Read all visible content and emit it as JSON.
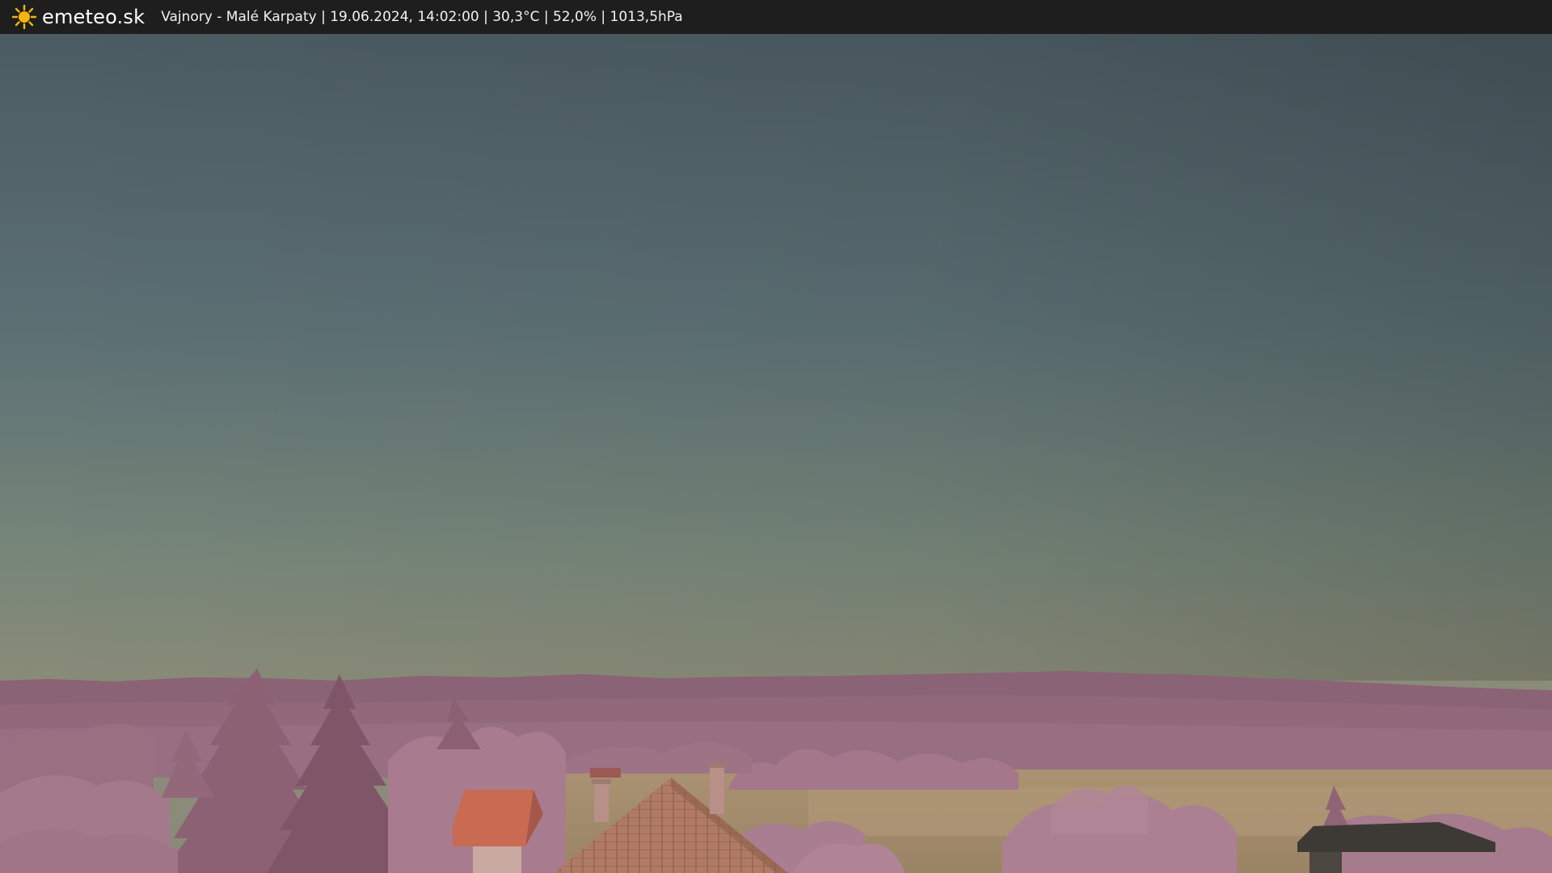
{
  "header": {
    "brand": "emeteo.sk",
    "logo_icon": "sun-icon",
    "caption": "Vajnory - Malé Karpaty | 19.06.2024, 14:02:00 | 30,3°C | 52,0% | 1013,5hPa"
  },
  "colors": {
    "bar_background": "#1e1e1e",
    "sun_yellow": "#f5b50c",
    "sky_top": "#4a5a60",
    "sky_horizon": "#8c8a76",
    "hills": "#8a6275",
    "foliage": "#a4778a",
    "field": "#a58e6c",
    "roof_tiles": "#b07a63"
  }
}
